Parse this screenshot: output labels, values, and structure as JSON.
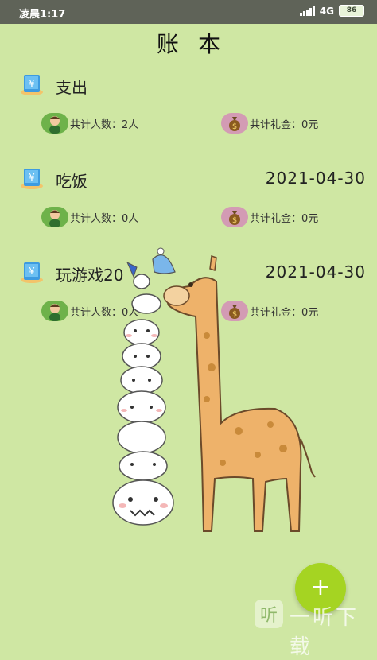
{
  "status": {
    "time": "凌晨1:17",
    "network": "4G",
    "battery": "86"
  },
  "page": {
    "title": "账本"
  },
  "books": [
    {
      "name": "支出",
      "date": "",
      "people": "共计人数：2人",
      "money": "共计礼金：0元"
    },
    {
      "name": "吃饭",
      "date": "2021-04-30",
      "people": "共计人数：0人",
      "money": "共计礼金：0元"
    },
    {
      "name": "玩游戏20",
      "date": "2021-04-30",
      "people": "共计人数：0人",
      "money": "共计礼金：0元"
    }
  ],
  "fab": {
    "label": "+"
  },
  "watermark": {
    "text": "一听下载"
  },
  "icons": {
    "book": "book-icon",
    "avatar": "person-avatar-icon",
    "money": "money-bag-icon",
    "add": "plus-icon"
  },
  "colors": {
    "background": "#cfe7a3",
    "status_bar": "#5f6358",
    "fab": "#a5d422"
  }
}
